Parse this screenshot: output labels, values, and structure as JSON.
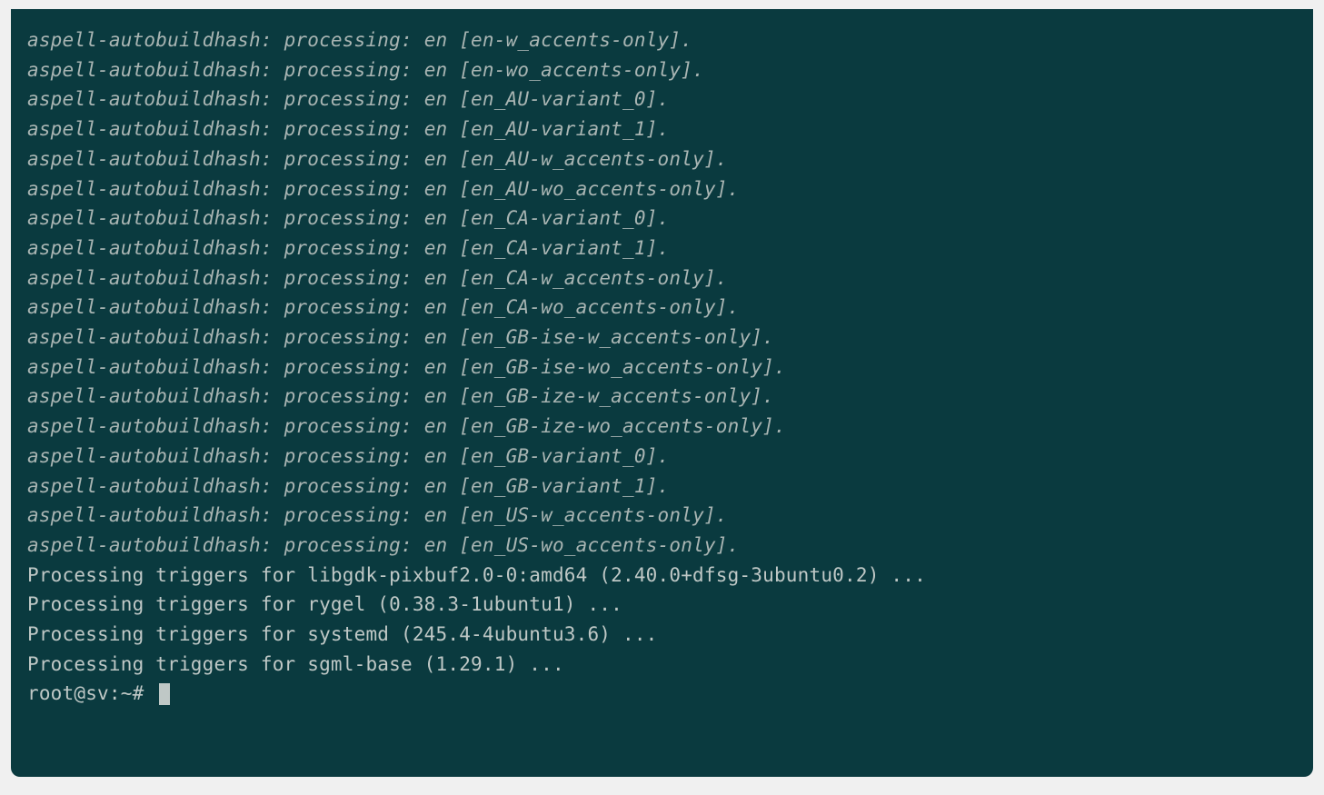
{
  "aspell": {
    "tool": "aspell-autobuildhash:",
    "processing": "processing:",
    "lang": "en",
    "dot": ".",
    "items": [
      "en-w_accents-only",
      "en-wo_accents-only",
      "en_AU-variant_0",
      "en_AU-variant_1",
      "en_AU-w_accents-only",
      "en_AU-wo_accents-only",
      "en_CA-variant_0",
      "en_CA-variant_1",
      "en_CA-w_accents-only",
      "en_CA-wo_accents-only",
      "en_GB-ise-w_accents-only",
      "en_GB-ise-wo_accents-only",
      "en_GB-ize-w_accents-only",
      "en_GB-ize-wo_accents-only",
      "en_GB-variant_0",
      "en_GB-variant_1",
      "en_US-w_accents-only",
      "en_US-wo_accents-only"
    ]
  },
  "triggers": [
    "Processing triggers for libgdk-pixbuf2.0-0:amd64 (2.40.0+dfsg-3ubuntu0.2) ...",
    "Processing triggers for rygel (0.38.3-1ubuntu1) ...",
    "Processing triggers for systemd (245.4-4ubuntu3.6) ...",
    "Processing triggers for sgml-base (1.29.1) ..."
  ],
  "prompt": "root@sv:~# "
}
